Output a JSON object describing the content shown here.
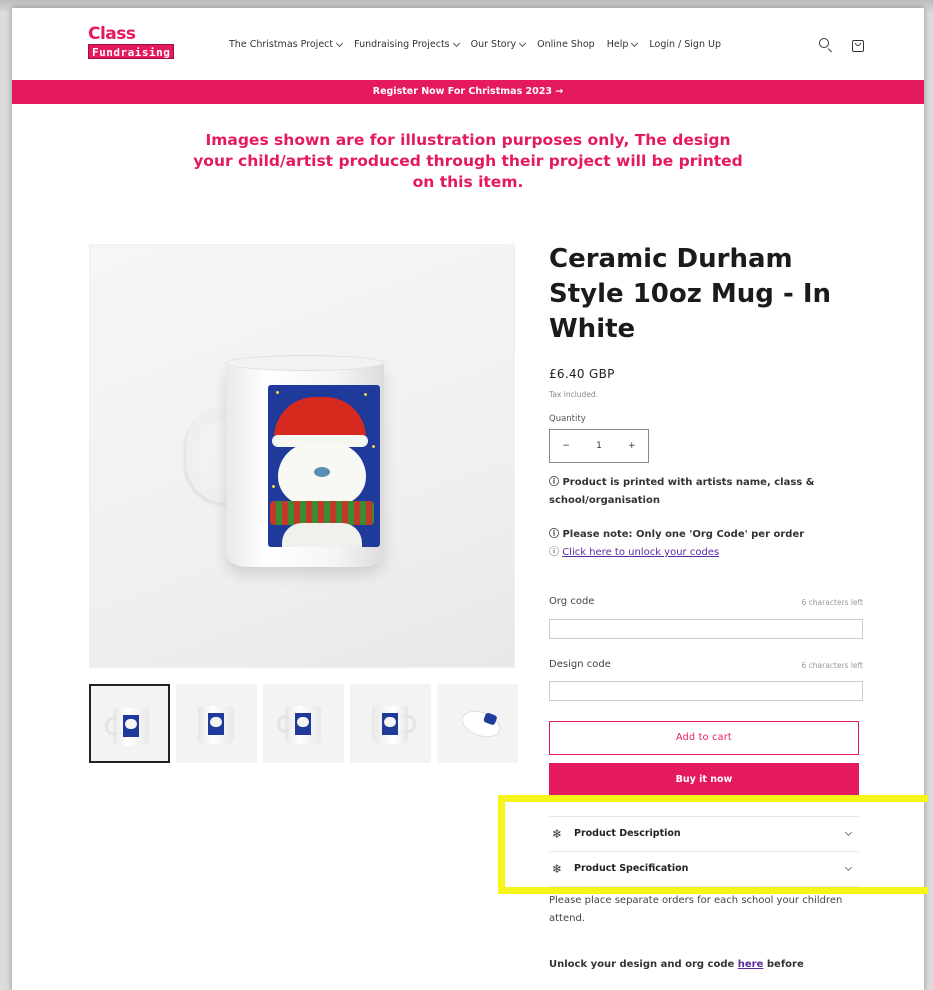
{
  "header": {
    "logo_top": "Class",
    "logo_bottom": "Fundraising",
    "nav": [
      {
        "label": "The Christmas Project",
        "has_dropdown": true
      },
      {
        "label": "Fundraising Projects",
        "has_dropdown": true
      },
      {
        "label": "Our Story",
        "has_dropdown": true
      },
      {
        "label": "Online Shop",
        "has_dropdown": false
      },
      {
        "label": "Help",
        "has_dropdown": true
      },
      {
        "label": "Login / Sign Up",
        "has_dropdown": false
      }
    ],
    "icons": [
      "search-icon",
      "cart-icon"
    ]
  },
  "banner": {
    "text": "Register Now For Christmas 2023 →"
  },
  "notice": {
    "text": "Images shown are for illustration purposes only, The design your child/artist produced through their project will be printed on this item."
  },
  "gallery": {
    "thumbnail_count": 5,
    "selected_index": 0
  },
  "product": {
    "title": "Ceramic Durham Style 10oz Mug - In White",
    "price": "£6.40 GBP",
    "tax_note": "Tax included.",
    "quantity_label": "Quantity",
    "quantity_value": "1",
    "minus": "−",
    "plus": "+",
    "note_printed": "ⓘ Product is printed with artists name, class & school/organisation",
    "note_org": "ⓘ Please note: Only one 'Org Code' per order",
    "unlock_prefix": "ⓘ ",
    "unlock_link": "Click here to unlock your codes",
    "org_label": "Org code",
    "org_chars": "6 characters left",
    "design_label": "Design code",
    "design_chars": "6 characters left",
    "add_to_cart": "Add to cart",
    "buy_now": "Buy it now",
    "accordion": [
      {
        "label": "Product Description"
      },
      {
        "label": "Product Specification"
      }
    ],
    "para1": "Please place separate orders for each school your children attend.",
    "para2_prefix": "Unlock your design and org code ",
    "para2_link": "here",
    "para2_suffix": " before"
  },
  "colors": {
    "brand": "#e5195f",
    "link": "#5b2ca0",
    "highlight": "#f5f51a"
  }
}
